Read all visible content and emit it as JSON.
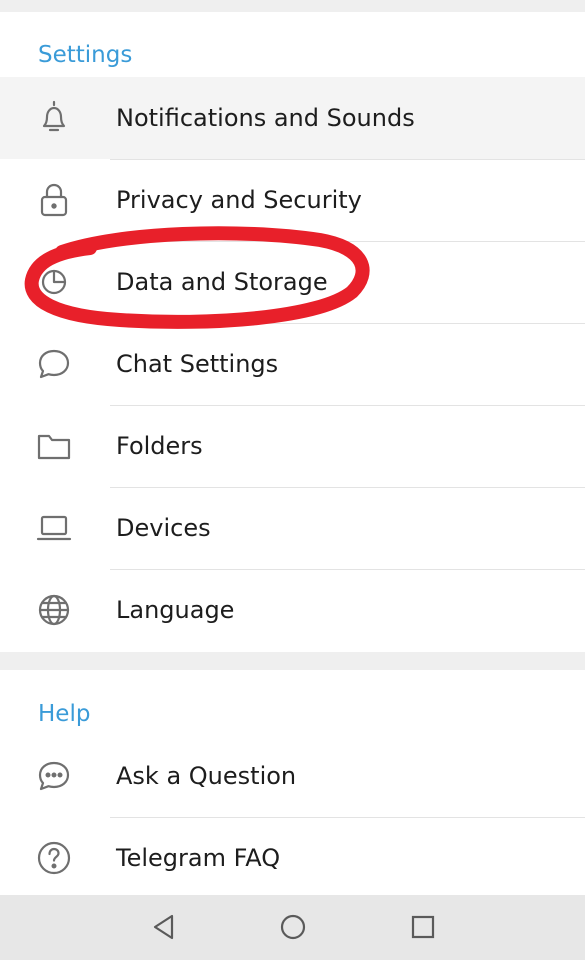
{
  "settings_section": {
    "title": "Settings",
    "items": [
      {
        "label": "Notifications and Sounds",
        "icon": "bell-icon"
      },
      {
        "label": "Privacy and Security",
        "icon": "lock-icon"
      },
      {
        "label": "Data and Storage",
        "icon": "pie-chart-icon"
      },
      {
        "label": "Chat Settings",
        "icon": "chat-bubble-icon"
      },
      {
        "label": "Folders",
        "icon": "folder-icon"
      },
      {
        "label": "Devices",
        "icon": "laptop-icon"
      },
      {
        "label": "Language",
        "icon": "globe-icon"
      }
    ]
  },
  "help_section": {
    "title": "Help",
    "items": [
      {
        "label": "Ask a Question",
        "icon": "chat-dots-icon"
      },
      {
        "label": "Telegram FAQ",
        "icon": "question-circle-icon"
      }
    ]
  },
  "nav_bar": {
    "buttons": [
      {
        "icon": "back-triangle-icon"
      },
      {
        "icon": "home-circle-icon"
      },
      {
        "icon": "recents-square-icon"
      }
    ]
  },
  "colors": {
    "accent": "#3a9bd8",
    "annotation": "#e8202a"
  },
  "annotation": {
    "target": "Data and Storage",
    "shape": "red hand-drawn ellipse"
  }
}
